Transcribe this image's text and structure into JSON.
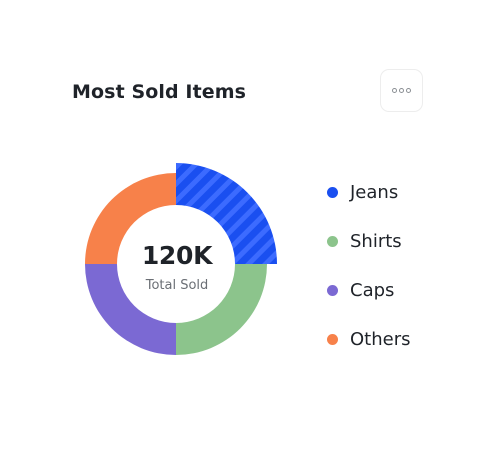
{
  "card": {
    "title": "Most Sold Items",
    "more_icon": "more-horizontal-icon"
  },
  "chart_data": {
    "type": "pie",
    "variant": "donut",
    "title": "Most Sold Items",
    "center": {
      "value": "120K",
      "label": "Total Sold"
    },
    "highlighted": "Jeans",
    "highlight_pattern": "diagonal-stripes",
    "legend_position": "right",
    "series": [
      {
        "name": "Jeans",
        "value": 25,
        "color": "#1a4ff0"
      },
      {
        "name": "Shirts",
        "value": 25,
        "color": "#8cc48c"
      },
      {
        "name": "Caps",
        "value": 25,
        "color": "#7b69d3"
      },
      {
        "name": "Others",
        "value": 25,
        "color": "#f7814a"
      }
    ]
  }
}
